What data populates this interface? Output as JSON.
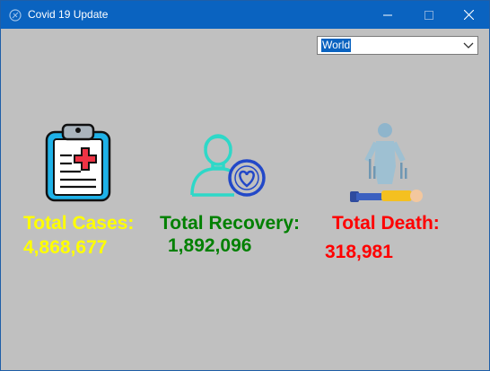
{
  "window": {
    "title": "Covid 19 Update"
  },
  "region_select": {
    "selected": "World"
  },
  "stats": {
    "cases": {
      "label": "Total Cases:",
      "value": "4,868,677",
      "color": "#ffff00"
    },
    "recovery": {
      "label": "Total Recovery:",
      "value": "1,892,096",
      "color": "#008000"
    },
    "death": {
      "label": "Total Death:",
      "value": "318,981",
      "color": "#ff0000"
    }
  },
  "icons": {
    "cases": "clipboard-medical-icon",
    "recovery": "patient-heart-icon",
    "death": "deceased-person-icon"
  }
}
